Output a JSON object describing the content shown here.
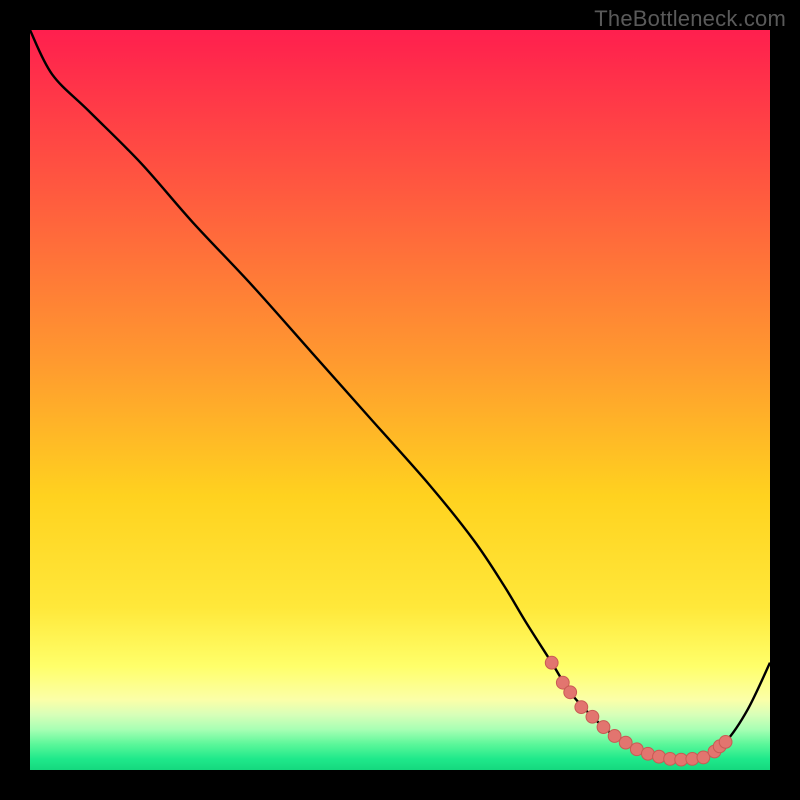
{
  "watermark": "TheBottleneck.com",
  "colors": {
    "background": "#000000",
    "curve": "#000000",
    "marker_fill": "#e2756f",
    "marker_stroke": "#c95a54",
    "gradient_stops": [
      {
        "offset": 0.0,
        "color": "#ff1f4e"
      },
      {
        "offset": 0.22,
        "color": "#ff5a3f"
      },
      {
        "offset": 0.45,
        "color": "#ff9a2f"
      },
      {
        "offset": 0.63,
        "color": "#ffd21f"
      },
      {
        "offset": 0.78,
        "color": "#ffe83a"
      },
      {
        "offset": 0.86,
        "color": "#ffff6a"
      },
      {
        "offset": 0.905,
        "color": "#fbffa8"
      },
      {
        "offset": 0.925,
        "color": "#d8ffb8"
      },
      {
        "offset": 0.945,
        "color": "#a8ffb4"
      },
      {
        "offset": 0.965,
        "color": "#5cf79a"
      },
      {
        "offset": 0.985,
        "color": "#1fe98b"
      },
      {
        "offset": 1.0,
        "color": "#15d87e"
      }
    ]
  },
  "chart_data": {
    "type": "line",
    "title": "",
    "xlabel": "",
    "ylabel": "",
    "xlim": [
      0,
      100
    ],
    "ylim": [
      0,
      100
    ],
    "grid": false,
    "legend": false,
    "series": [
      {
        "name": "curve",
        "x": [
          0,
          3,
          8,
          15,
          22,
          30,
          38,
          46,
          54,
          60,
          64,
          67,
          70.5,
          73,
          76,
          79,
          82,
          85,
          88,
          91,
          94,
          97,
          100
        ],
        "y": [
          100,
          94,
          89,
          82,
          74,
          65.5,
          56.5,
          47.5,
          38.5,
          31,
          25,
          20,
          14.5,
          10.5,
          7.2,
          4.6,
          2.8,
          1.8,
          1.4,
          1.7,
          3.8,
          8.2,
          14.5
        ]
      }
    ],
    "markers": {
      "name": "optimal-band",
      "points": [
        {
          "x": 70.5,
          "y": 14.5
        },
        {
          "x": 72.0,
          "y": 11.8
        },
        {
          "x": 73.0,
          "y": 10.5
        },
        {
          "x": 74.5,
          "y": 8.5
        },
        {
          "x": 76.0,
          "y": 7.2
        },
        {
          "x": 77.5,
          "y": 5.8
        },
        {
          "x": 79.0,
          "y": 4.6
        },
        {
          "x": 80.5,
          "y": 3.7
        },
        {
          "x": 82.0,
          "y": 2.8
        },
        {
          "x": 83.5,
          "y": 2.2
        },
        {
          "x": 85.0,
          "y": 1.8
        },
        {
          "x": 86.5,
          "y": 1.5
        },
        {
          "x": 88.0,
          "y": 1.4
        },
        {
          "x": 89.5,
          "y": 1.5
        },
        {
          "x": 91.0,
          "y": 1.7
        },
        {
          "x": 92.5,
          "y": 2.5
        },
        {
          "x": 93.2,
          "y": 3.2
        },
        {
          "x": 94.0,
          "y": 3.8
        }
      ]
    }
  }
}
